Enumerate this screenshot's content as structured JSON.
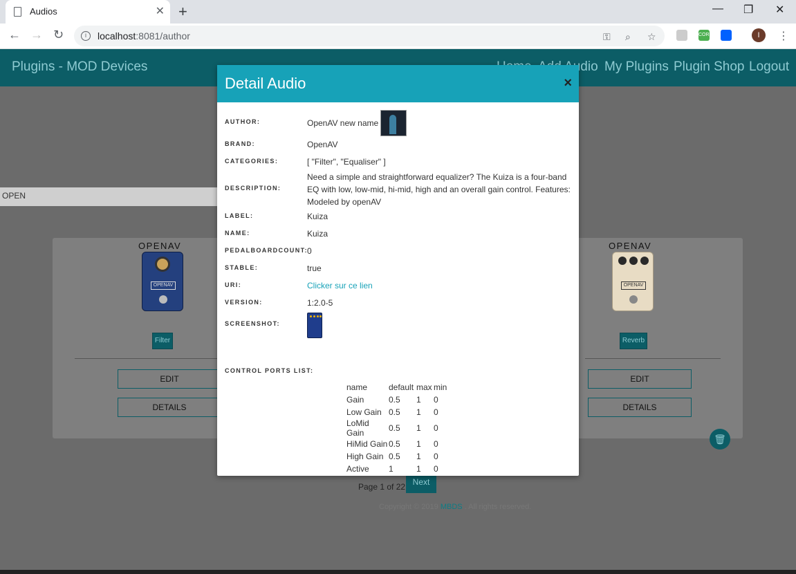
{
  "browser": {
    "tab_title": "Audios",
    "tab_close": "✕",
    "new_tab": "+",
    "url_host": "localhost",
    "url_rest": ":8081/author",
    "avatar_letter": "I",
    "window_controls": {
      "minimize": "—",
      "restore": "❐",
      "close": "✕"
    }
  },
  "navbar": {
    "brand": "Plugins - MOD Devices",
    "links": [
      "Home",
      "Add Audio",
      "My Plugins",
      "Plugin Shop",
      "Logout"
    ]
  },
  "search": {
    "value": "OPEN"
  },
  "cards": [
    {
      "brand": "OPENAV",
      "tag": "Filter",
      "edit": "EDIT",
      "details": "DETAILS",
      "pedal_color": "#24407e"
    },
    {
      "brand": "OPENAV",
      "tag": "Reverb",
      "edit": "EDIT",
      "details": "DETAILS",
      "pedal_color": "#e8dcc4"
    }
  ],
  "pagination": {
    "text": "Page 1 of 22",
    "next": "Next"
  },
  "footer": {
    "prefix": "Copyright © 2019",
    "link": "MBDS",
    "suffix": ". All rights reserved."
  },
  "modal": {
    "title": "Detail Audio",
    "close": "×",
    "fields": {
      "author": {
        "label": "AUTHOR:",
        "value": "OpenAV new name"
      },
      "brand": {
        "label": "BRAND:",
        "value": "OpenAV"
      },
      "categories": {
        "label": "CATEGORIES:",
        "value": "[ \"Filter\", \"Equaliser\" ]"
      },
      "description": {
        "label": "DESCRIPTION:",
        "value": "Need a simple and straightforward equalizer? The Kuiza is a four-band EQ with low, low-mid, hi-mid, high and an overall gain control. Features: Modeled by openAV"
      },
      "label": {
        "label": "LABEL:",
        "value": "Kuiza"
      },
      "name": {
        "label": "NAME:",
        "value": "Kuiza"
      },
      "pedalboardcount": {
        "label": "PEDALBOARDCOUNT:",
        "value": "0"
      },
      "stable": {
        "label": "STABLE:",
        "value": "true"
      },
      "uri": {
        "label": "URI:",
        "value": "Clicker sur ce lien"
      },
      "version": {
        "label": "VERSION:",
        "value": "1:2.0-5"
      },
      "screenshot": {
        "label": "SCREENSHOT:"
      },
      "control_ports": {
        "label": "CONTROL PORTS LIST:"
      }
    },
    "ports": {
      "headers": [
        "name",
        "default",
        "max",
        "min"
      ],
      "rows": [
        [
          "Gain",
          "0.5",
          "1",
          "0"
        ],
        [
          "Low Gain",
          "0.5",
          "1",
          "0"
        ],
        [
          "LoMid Gain",
          "0.5",
          "1",
          "0"
        ],
        [
          "HiMid Gain",
          "0.5",
          "1",
          "0"
        ],
        [
          "High Gain",
          "0.5",
          "1",
          "0"
        ],
        [
          "Active",
          "1",
          "1",
          "0"
        ]
      ]
    }
  }
}
